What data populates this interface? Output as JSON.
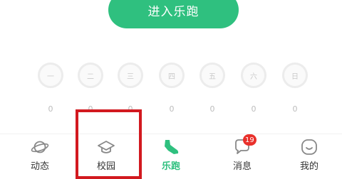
{
  "start_button": {
    "label": "进入乐跑"
  },
  "weekdays": [
    {
      "label": "一",
      "count": "0"
    },
    {
      "label": "二",
      "count": "0"
    },
    {
      "label": "三",
      "count": "0"
    },
    {
      "label": "四",
      "count": "0"
    },
    {
      "label": "五",
      "count": "0"
    },
    {
      "label": "六",
      "count": "0"
    },
    {
      "label": "日",
      "count": "0"
    }
  ],
  "tabbar": {
    "items": [
      {
        "label": "动态",
        "icon": "planet-icon"
      },
      {
        "label": "校园",
        "icon": "graduation-cap-icon"
      },
      {
        "label": "乐跑",
        "icon": "running-shoe-icon",
        "active": true
      },
      {
        "label": "消息",
        "icon": "chat-bubble-icon",
        "badge": "19"
      },
      {
        "label": "我的",
        "icon": "smiley-face-icon"
      }
    ]
  },
  "colors": {
    "accent": "#2fc07f",
    "badge": "#e9302b",
    "highlight_box": "#d2191f"
  }
}
